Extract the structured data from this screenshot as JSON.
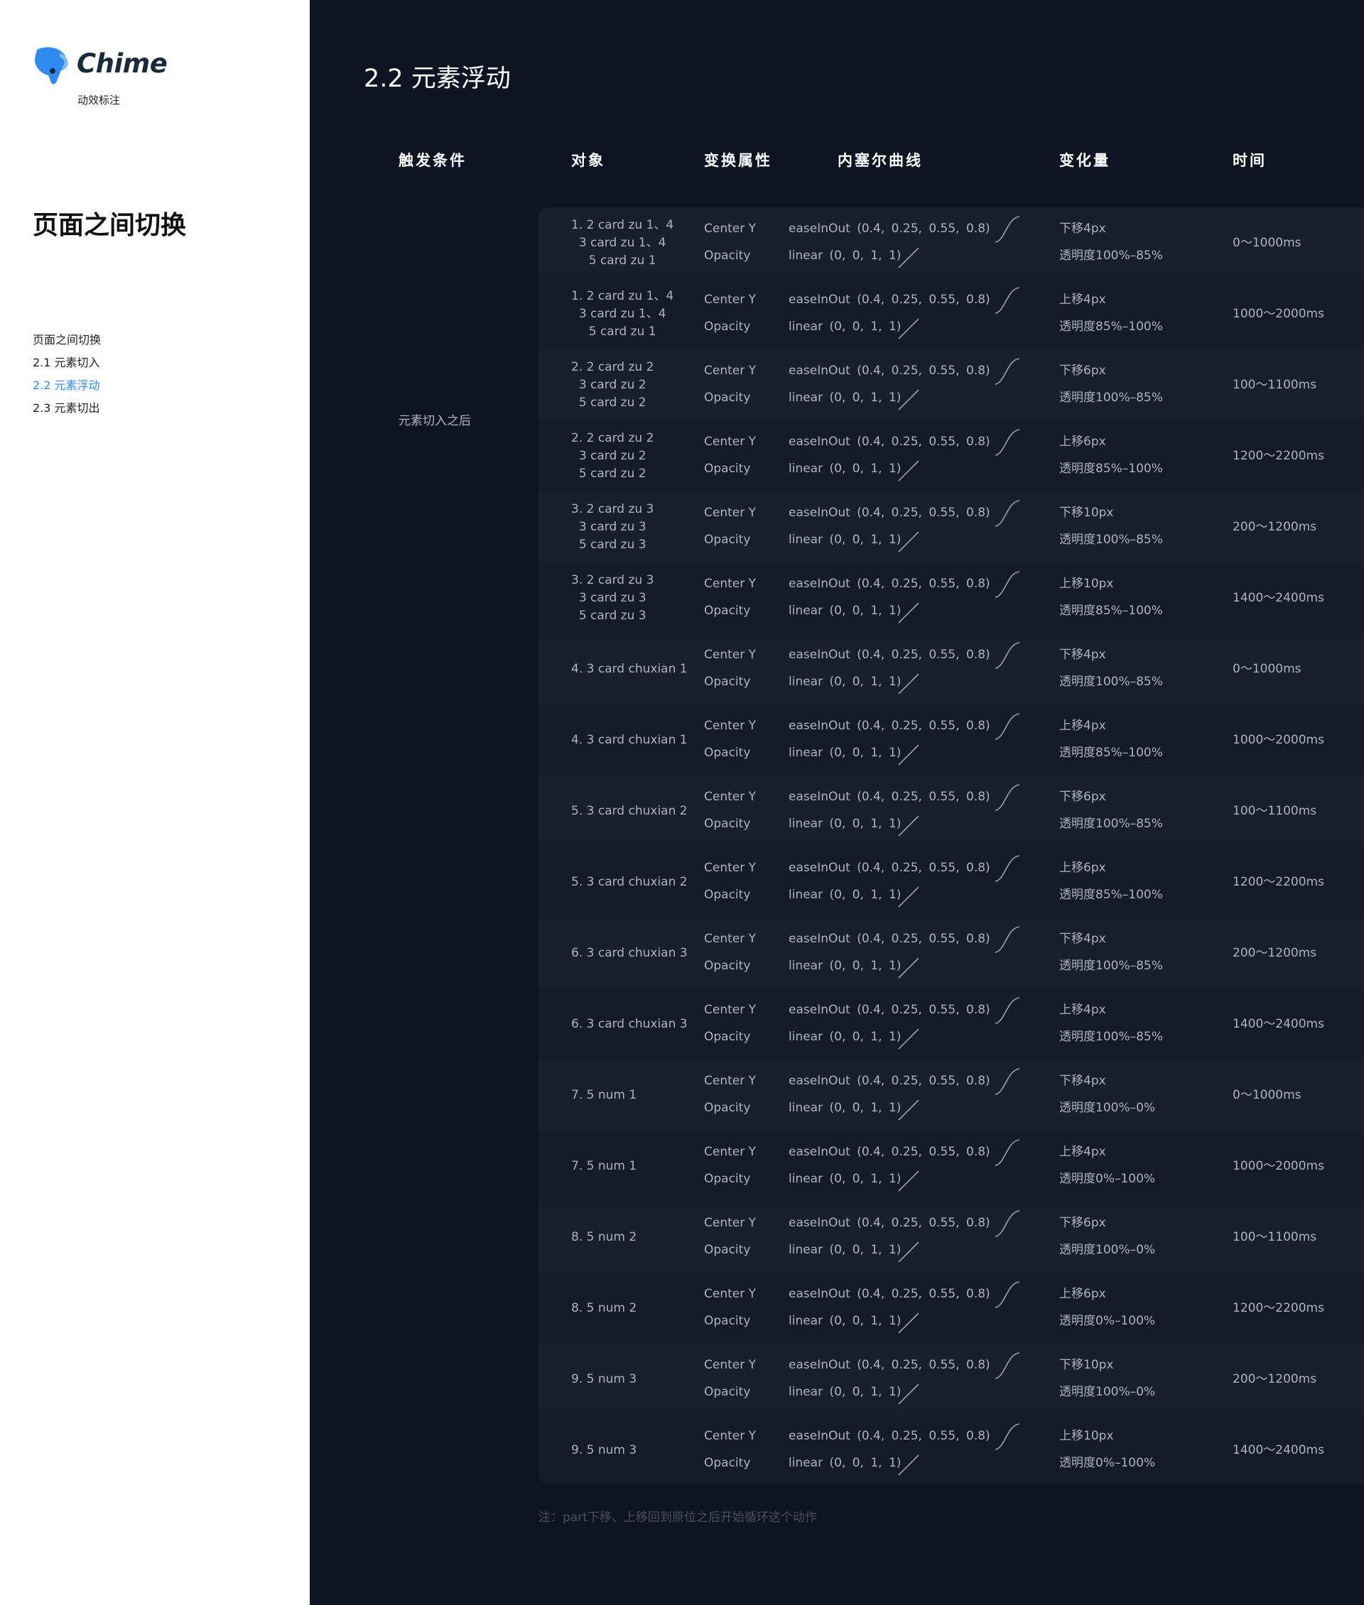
{
  "brand": {
    "name": "Chime",
    "subtitle": "动效标注",
    "color": "#2f8bf0"
  },
  "sidebar": {
    "page_title": "页面之间切换",
    "toc": [
      {
        "label": "页面之间切换",
        "active": false
      },
      {
        "label": "2.1 元素切入",
        "active": false
      },
      {
        "label": "2.2 元素浮动",
        "active": true
      },
      {
        "label": "2.3 元素切出",
        "active": false
      }
    ]
  },
  "main": {
    "section_title": "2.2 元素浮动",
    "headers": {
      "trigger": "触发条件",
      "object": "对象",
      "property": "变换属性",
      "bezier": "内塞尔曲线",
      "change": "变化量",
      "time": "时间"
    },
    "trigger_value": "元素切入之后",
    "rows": [
      {
        "object": [
          "1. 2 card zu 1、4",
          "3 card zu 1、4",
          "5 card zu 1"
        ],
        "prop1": "Center Y",
        "curve1": "easeInOut (0.4, 0.25, 0.55, 0.8)",
        "prop2": "Opacity",
        "curve2": "linear (0, 0, 1, 1)",
        "change1": "下移4px",
        "change2": "透明度100%–85%",
        "time": "0～1000ms"
      },
      {
        "object": [
          "1. 2 card zu 1、4",
          "3 card zu 1、4",
          "5 card zu 1"
        ],
        "prop1": "Center Y",
        "curve1": "easeInOut (0.4, 0.25, 0.55, 0.8)",
        "prop2": "Opacity",
        "curve2": "linear (0, 0, 1, 1)",
        "change1": "上移4px",
        "change2": "透明度85%–100%",
        "time": "1000～2000ms"
      },
      {
        "object": [
          "2. 2 card zu 2",
          "3 card zu 2",
          "5 card zu 2"
        ],
        "prop1": "Center Y",
        "curve1": "easeInOut (0.4, 0.25, 0.55, 0.8)",
        "prop2": "Opacity",
        "curve2": "linear (0, 0, 1, 1)",
        "change1": "下移6px",
        "change2": "透明度100%–85%",
        "time": "100～1100ms"
      },
      {
        "object": [
          "2. 2 card zu 2",
          "3 card zu 2",
          "5 card zu 2"
        ],
        "prop1": "Center Y",
        "curve1": "easeInOut (0.4, 0.25, 0.55, 0.8)",
        "prop2": "Opacity",
        "curve2": "linear (0, 0, 1, 1)",
        "change1": "上移6px",
        "change2": "透明度85%–100%",
        "time": "1200～2200ms"
      },
      {
        "object": [
          "3. 2 card zu 3",
          "3 card zu 3",
          "5 card zu 3"
        ],
        "prop1": "Center Y",
        "curve1": "easeInOut (0.4, 0.25, 0.55, 0.8)",
        "prop2": "Opacity",
        "curve2": "linear (0, 0, 1, 1)",
        "change1": "下移10px",
        "change2": "透明度100%–85%",
        "time": "200～1200ms"
      },
      {
        "object": [
          "3. 2 card zu 3",
          "3 card zu 3",
          "5 card zu 3"
        ],
        "prop1": "Center Y",
        "curve1": "easeInOut (0.4, 0.25, 0.55, 0.8)",
        "prop2": "Opacity",
        "curve2": "linear (0, 0, 1, 1)",
        "change1": "上移10px",
        "change2": "透明度85%–100%",
        "time": "1400～2400ms"
      },
      {
        "object": [
          "4. 3 card chuxian 1"
        ],
        "prop1": "Center Y",
        "curve1": "easeInOut (0.4, 0.25, 0.55, 0.8)",
        "prop2": "Opacity",
        "curve2": "linear (0, 0, 1, 1)",
        "change1": "下移4px",
        "change2": "透明度100%–85%",
        "time": "0～1000ms"
      },
      {
        "object": [
          "4. 3 card chuxian 1"
        ],
        "prop1": "Center Y",
        "curve1": "easeInOut (0.4, 0.25, 0.55, 0.8)",
        "prop2": "Opacity",
        "curve2": "linear (0, 0, 1, 1)",
        "change1": "上移4px",
        "change2": "透明度85%–100%",
        "time": "1000～2000ms"
      },
      {
        "object": [
          "5. 3 card chuxian 2"
        ],
        "prop1": "Center Y",
        "curve1": "easeInOut (0.4, 0.25, 0.55, 0.8)",
        "prop2": "Opacity",
        "curve2": "linear (0, 0, 1, 1)",
        "change1": "下移6px",
        "change2": "透明度100%–85%",
        "time": "100～1100ms"
      },
      {
        "object": [
          "5. 3 card chuxian 2"
        ],
        "prop1": "Center Y",
        "curve1": "easeInOut (0.4, 0.25, 0.55, 0.8)",
        "prop2": "Opacity",
        "curve2": "linear (0, 0, 1, 1)",
        "change1": "上移6px",
        "change2": "透明度85%–100%",
        "time": "1200～2200ms"
      },
      {
        "object": [
          "6. 3 card chuxian 3"
        ],
        "prop1": "Center Y",
        "curve1": "easeInOut (0.4, 0.25, 0.55, 0.8)",
        "prop2": "Opacity",
        "curve2": "linear (0, 0, 1, 1)",
        "change1": "下移4px",
        "change2": "透明度100%–85%",
        "time": "200～1200ms"
      },
      {
        "object": [
          "6. 3 card chuxian 3"
        ],
        "prop1": "Center Y",
        "curve1": "easeInOut (0.4, 0.25, 0.55, 0.8)",
        "prop2": "Opacity",
        "curve2": "linear (0, 0, 1, 1)",
        "change1": "上移4px",
        "change2": "透明度100%–85%",
        "time": "1400～2400ms"
      },
      {
        "object": [
          "7. 5 num 1"
        ],
        "prop1": "Center Y",
        "curve1": "easeInOut (0.4, 0.25, 0.55, 0.8)",
        "prop2": "Opacity",
        "curve2": "linear (0, 0, 1, 1)",
        "change1": "下移4px",
        "change2": "透明度100%–0%",
        "time": "0～1000ms"
      },
      {
        "object": [
          "7. 5 num 1"
        ],
        "prop1": "Center Y",
        "curve1": "easeInOut (0.4, 0.25, 0.55, 0.8)",
        "prop2": "Opacity",
        "curve2": "linear (0, 0, 1, 1)",
        "change1": "上移4px",
        "change2": "透明度0%–100%",
        "time": "1000～2000ms"
      },
      {
        "object": [
          "8. 5 num 2"
        ],
        "prop1": "Center Y",
        "curve1": "easeInOut (0.4, 0.25, 0.55, 0.8)",
        "prop2": "Opacity",
        "curve2": "linear (0, 0, 1, 1)",
        "change1": "下移6px",
        "change2": "透明度100%–0%",
        "time": "100～1100ms"
      },
      {
        "object": [
          "8. 5 num 2"
        ],
        "prop1": "Center Y",
        "curve1": "easeInOut (0.4, 0.25, 0.55, 0.8)",
        "prop2": "Opacity",
        "curve2": "linear (0, 0, 1, 1)",
        "change1": "上移6px",
        "change2": "透明度0%–100%",
        "time": "1200～2200ms"
      },
      {
        "object": [
          "9. 5 num 3"
        ],
        "prop1": "Center Y",
        "curve1": "easeInOut (0.4, 0.25, 0.55, 0.8)",
        "prop2": "Opacity",
        "curve2": "linear (0, 0, 1, 1)",
        "change1": "下移10px",
        "change2": "透明度100%–0%",
        "time": "200～1200ms"
      },
      {
        "object": [
          "9. 5 num 3"
        ],
        "prop1": "Center Y",
        "curve1": "easeInOut (0.4, 0.25, 0.55, 0.8)",
        "prop2": "Opacity",
        "curve2": "linear (0, 0, 1, 1)",
        "change1": "上移10px",
        "change2": "透明度0%–100%",
        "time": "1400～2400ms"
      }
    ],
    "note": "注：part下移、上移回到原位之后开始循环这个动作"
  }
}
